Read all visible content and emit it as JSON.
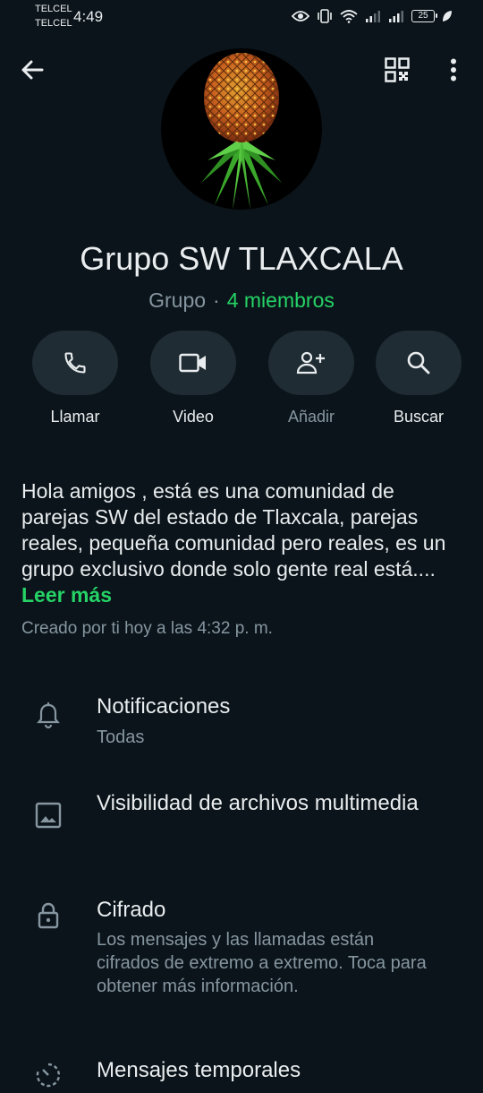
{
  "status_bar": {
    "carrier_1": "TELCEL",
    "carrier_2": "TELCEL",
    "time": "4:49",
    "battery": "25"
  },
  "top_bar": {
    "back_icon": "arrow-left-icon",
    "qr_icon": "qr-code-icon",
    "more_icon": "more-vert-icon"
  },
  "group": {
    "name": "Grupo SW TLAXCALA",
    "type": "Grupo",
    "separator": "·",
    "members": "4 miembros"
  },
  "actions": [
    {
      "label": "Llamar",
      "icon": "phone-icon"
    },
    {
      "label": "Video",
      "icon": "video-icon"
    },
    {
      "label": "Añadir",
      "icon": "add-person-icon"
    },
    {
      "label": "Buscar",
      "icon": "search-icon"
    }
  ],
  "description": {
    "text": "Hola amigos , está es una comunidad de parejas SW  del estado de Tlaxcala, parejas reales, pequeña comunidad pero reales, es un grupo exclusivo donde solo gente real está....",
    "read_more": "Leer más",
    "created": "Creado por ti hoy a las 4:32 p. m."
  },
  "settings": [
    {
      "title": "Notificaciones",
      "subtitle": "Todas",
      "icon": "bell-icon"
    },
    {
      "title": "Visibilidad de archivos multimedia",
      "subtitle": "",
      "icon": "image-icon"
    },
    {
      "title": "Cifrado",
      "subtitle": "Los mensajes y las llamadas están cifrados de extremo a extremo. Toca para obtener más información.",
      "icon": "lock-icon"
    },
    {
      "title": "Mensajes temporales",
      "subtitle": "",
      "icon": "timer-icon"
    }
  ],
  "colors": {
    "background": "#0b141a",
    "accent": "#25d366",
    "button_bg": "#1f2c33",
    "secondary_text": "#8696a0"
  }
}
